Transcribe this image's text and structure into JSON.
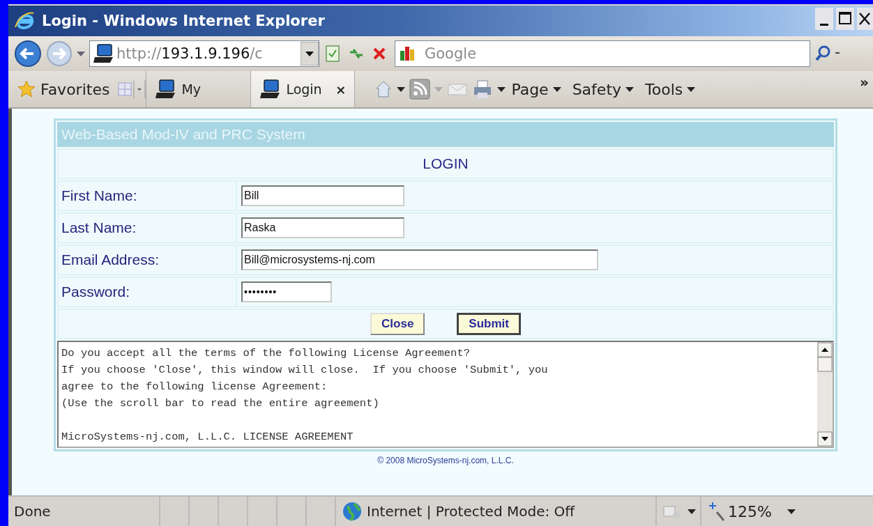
{
  "window": {
    "title": "Login - Windows Internet Explorer"
  },
  "address_bar": {
    "url": "http://**193.1.9.196**/c",
    "search_placeholder": "Google"
  },
  "favorites_bar": {
    "favorites_label": "Favorites",
    "tabs": [
      {
        "label": "My",
        "selected": false
      },
      {
        "label": "Login",
        "selected": true,
        "close": "×"
      }
    ],
    "menus": [
      "Page",
      "Safety",
      "Tools"
    ],
    "overflow": "»"
  },
  "page": {
    "header": "Web-Based Mod-IV and PRC System",
    "subheader": "LOGIN",
    "fields": [
      {
        "label": "First Name:",
        "value": "Bill",
        "kind": "short"
      },
      {
        "label": "Last Name:",
        "value": "Raska",
        "kind": "short"
      },
      {
        "label": "Email Address:",
        "value": "Bill@microsystems-nj.com",
        "kind": "long"
      },
      {
        "label": "Password:",
        "value": "••••••••",
        "kind": "password"
      }
    ],
    "buttons": [
      {
        "label": "Close",
        "default": false
      },
      {
        "label": "Submit",
        "default": true
      }
    ],
    "agreement": "Do you accept all the terms of the following License Agreement?\nIf you choose 'Close', this window will close.  If you choose 'Submit', you\nagree to the following license Agreement:\n(Use the scroll bar to read the entire agreement)\n\nMicroSystems-nj.com, L.L.C. LICENSE AGREEMENT",
    "footer": "© 2008 MicroSystems-nj.com, L.L.C."
  },
  "status_bar": {
    "status": "Done",
    "zone": "Internet | Protected Mode: Off",
    "zoom": "125%"
  }
}
